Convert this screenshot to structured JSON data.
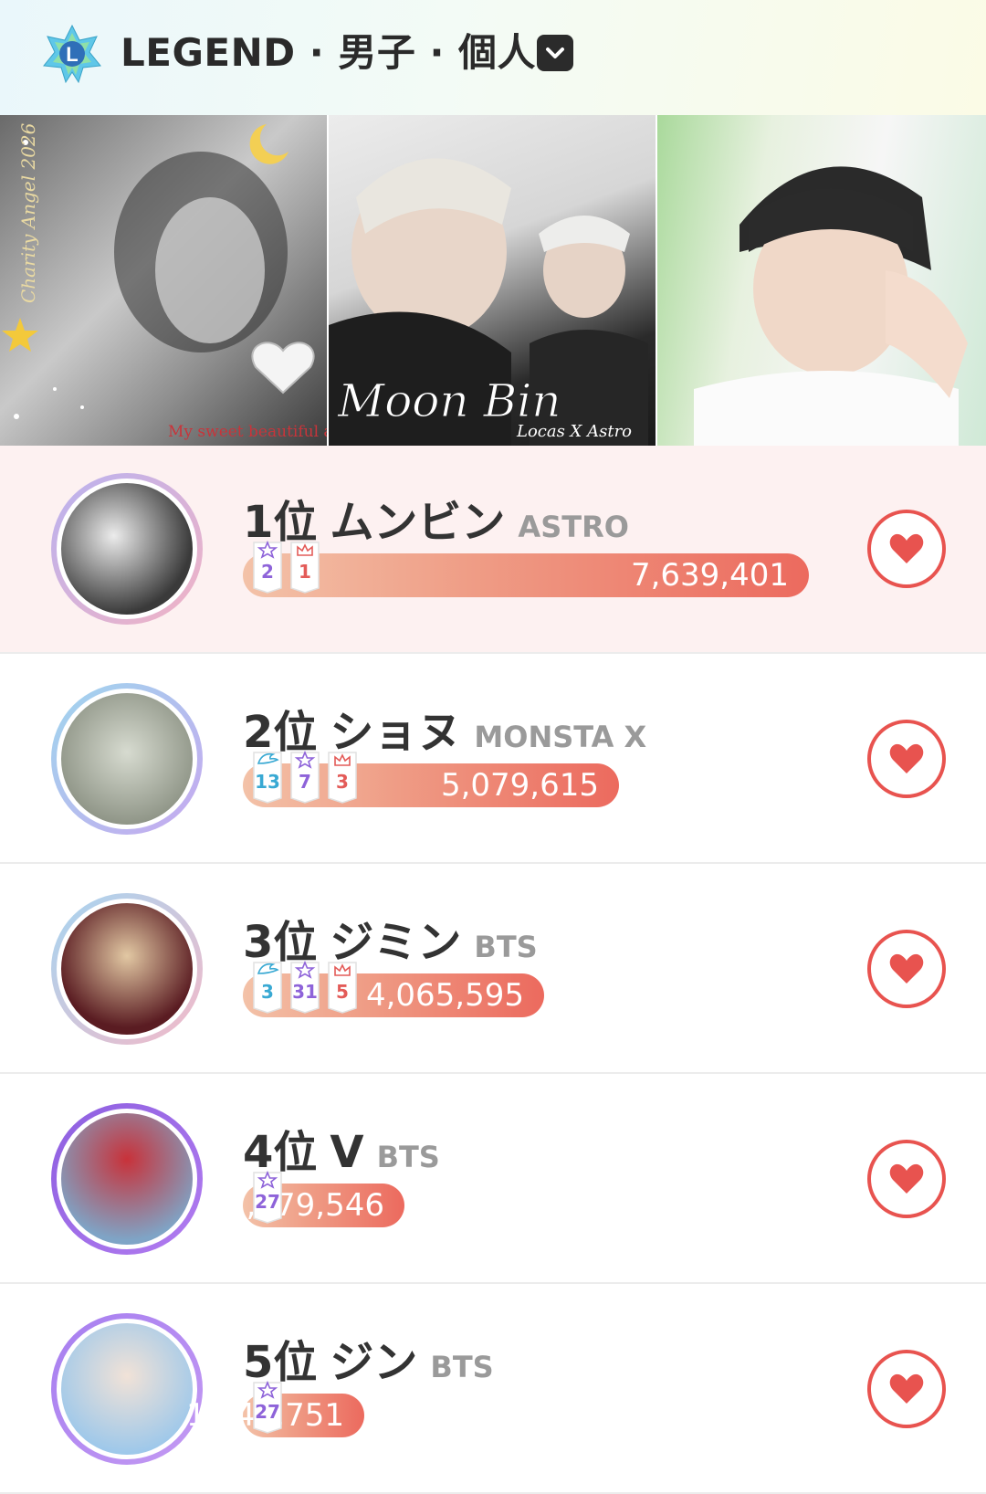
{
  "header": {
    "title": "LEGEND · 男子 · 個人",
    "logo_icon": "legend-star-logo",
    "dropdown_icon": "chevron-down-icon",
    "logo_letter": "L"
  },
  "banner": {
    "panel1_texts": [
      "Charity Angel 2026",
      "My sweet beautiful angel"
    ],
    "panel2_texts": [
      "Moon Bin",
      "Locas X Astro"
    ]
  },
  "colors": {
    "bar_start": "#f3c2a8",
    "bar_end": "#ec6a5e",
    "heart": "#e8534f",
    "first_row_bg": "#fdf1f1"
  },
  "rankings": [
    {
      "rank": "1位",
      "name": "ムンビン",
      "group": "ASTRO",
      "votes": "7,639,401",
      "bar_fraction": 1.0,
      "badges": [
        {
          "type": "star",
          "num": "2"
        },
        {
          "type": "crown",
          "num": "1"
        }
      ]
    },
    {
      "rank": "2位",
      "name": "ショヌ",
      "group": "MONSTA X",
      "votes": "5,079,615",
      "bar_fraction": 0.665,
      "badges": [
        {
          "type": "wing",
          "num": "13"
        },
        {
          "type": "star",
          "num": "7"
        },
        {
          "type": "crown",
          "num": "3"
        }
      ]
    },
    {
      "rank": "3位",
      "name": "ジミン",
      "group": "BTS",
      "votes": "4,065,595",
      "bar_fraction": 0.532,
      "badges": [
        {
          "type": "wing",
          "num": "3"
        },
        {
          "type": "star",
          "num": "31"
        },
        {
          "type": "crown",
          "num": "5"
        }
      ]
    },
    {
      "rank": "4位",
      "name": "V",
      "group": "BTS",
      "votes": "2,179,546",
      "bar_fraction": 0.285,
      "badges": [
        {
          "type": "star",
          "num": "27"
        }
      ]
    },
    {
      "rank": "5位",
      "name": "ジン",
      "group": "BTS",
      "votes": "1,641,751",
      "bar_fraction": 0.215,
      "badges": [
        {
          "type": "star",
          "num": "27"
        }
      ]
    }
  ]
}
